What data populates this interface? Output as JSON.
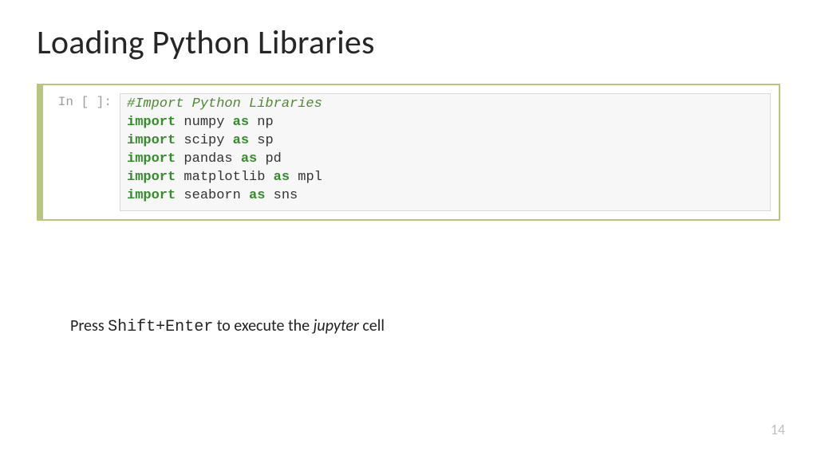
{
  "title": "Loading Python Libraries",
  "cell": {
    "prompt": "In [ ]:",
    "lines": [
      {
        "tokens": [
          {
            "t": "#Import Python Libraries",
            "cls": "tok-comment"
          }
        ]
      },
      {
        "tokens": [
          {
            "t": "import",
            "cls": "tok-keyword"
          },
          {
            "t": " numpy ",
            "cls": "tok-name"
          },
          {
            "t": "as",
            "cls": "tok-keyword"
          },
          {
            "t": " np",
            "cls": "tok-name"
          }
        ]
      },
      {
        "tokens": [
          {
            "t": "import",
            "cls": "tok-keyword"
          },
          {
            "t": " scipy ",
            "cls": "tok-name"
          },
          {
            "t": "as",
            "cls": "tok-keyword"
          },
          {
            "t": " sp",
            "cls": "tok-name"
          }
        ]
      },
      {
        "tokens": [
          {
            "t": "import",
            "cls": "tok-keyword"
          },
          {
            "t": " pandas ",
            "cls": "tok-name"
          },
          {
            "t": "as",
            "cls": "tok-keyword"
          },
          {
            "t": " pd",
            "cls": "tok-name"
          }
        ]
      },
      {
        "tokens": [
          {
            "t": "import",
            "cls": "tok-keyword"
          },
          {
            "t": " matplotlib ",
            "cls": "tok-name"
          },
          {
            "t": "as",
            "cls": "tok-keyword"
          },
          {
            "t": " mpl",
            "cls": "tok-name"
          }
        ]
      },
      {
        "tokens": [
          {
            "t": "import",
            "cls": "tok-keyword"
          },
          {
            "t": " seaborn ",
            "cls": "tok-name"
          },
          {
            "t": "as",
            "cls": "tok-keyword"
          },
          {
            "t": " sns",
            "cls": "tok-name"
          }
        ]
      }
    ]
  },
  "caption": {
    "pre": "Press ",
    "key": "Shift+Enter",
    "mid": " to execute the ",
    "em": "jupyter",
    "post": " cell"
  },
  "page_number": "14"
}
